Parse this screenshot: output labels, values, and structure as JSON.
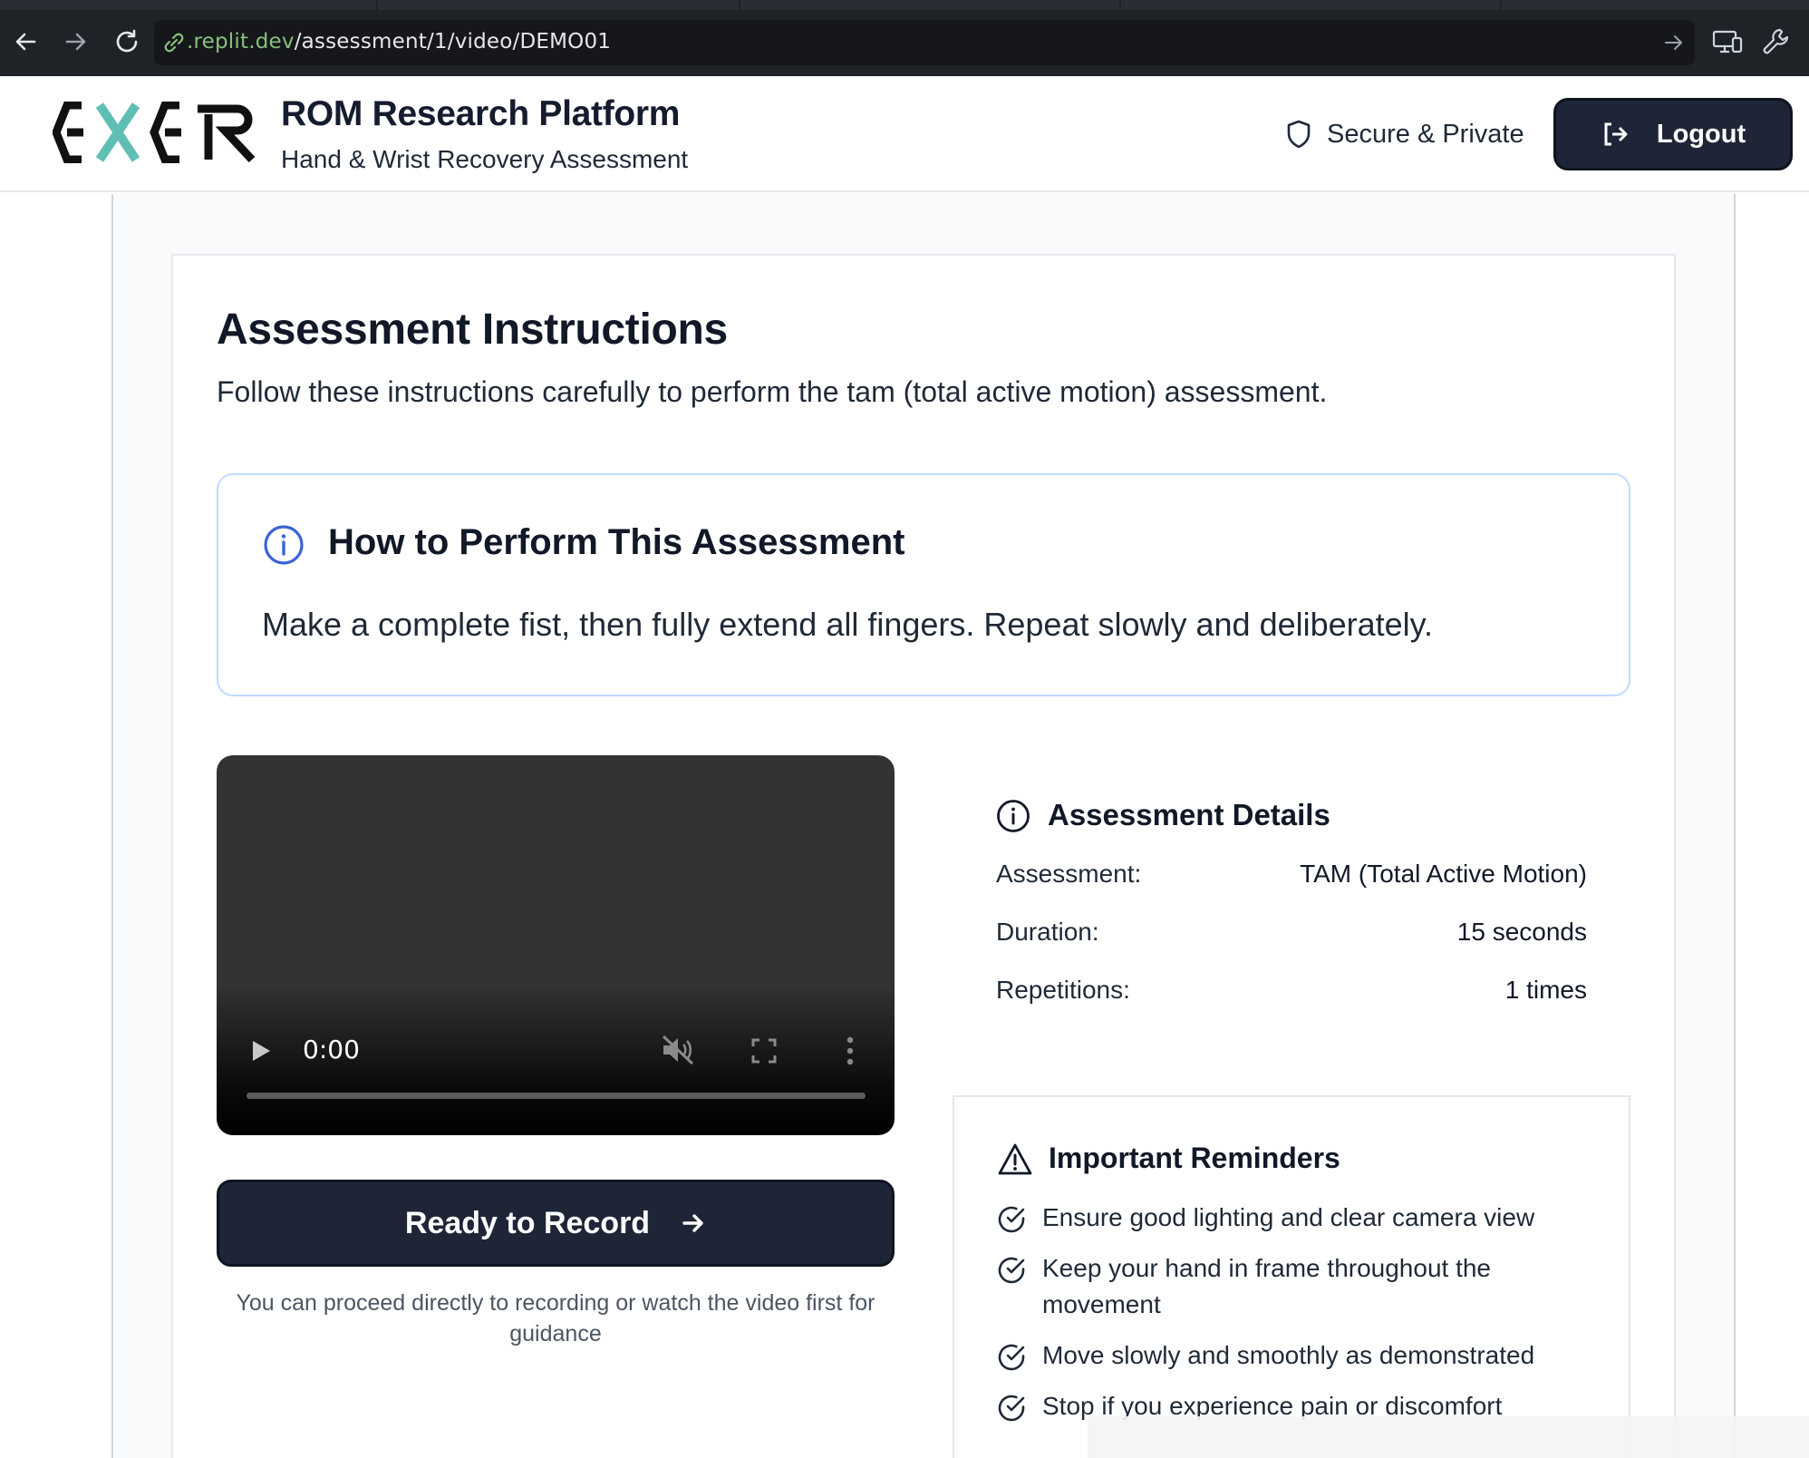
{
  "browser": {
    "url_host": ".replit.dev",
    "url_path": "/assessment/1/video/DEMO01"
  },
  "header": {
    "title": "ROM Research Platform",
    "subtitle": "Hand & Wrist Recovery Assessment",
    "secure_label": "Secure & Private",
    "logout_label": "Logout"
  },
  "instructions": {
    "title": "Assessment Instructions",
    "intro": "Follow these instructions carefully to perform the tam (total active motion) assessment.",
    "howto_title": "How to Perform This Assessment",
    "howto_text": "Make a complete fist, then fully extend all fingers. Repeat slowly and deliberately."
  },
  "video": {
    "time": "0:00",
    "progress": 0
  },
  "record": {
    "button_label": "Ready to Record",
    "note": "You can proceed directly to recording or watch the video first for guidance"
  },
  "details": {
    "title": "Assessment Details",
    "rows": [
      {
        "label": "Assessment:",
        "value": "TAM (Total Active Motion)"
      },
      {
        "label": "Duration:",
        "value": "15 seconds"
      },
      {
        "label": "Repetitions:",
        "value": "1 times"
      }
    ]
  },
  "reminders": {
    "title": "Important Reminders",
    "items": [
      "Ensure good lighting and clear camera view",
      "Keep your hand in frame throughout the movement",
      "Move slowly and smoothly as demonstrated",
      "Stop if you experience pain or discomfort"
    ]
  },
  "colors": {
    "primary_dark": "#1d2536",
    "accent_teal": "#5fbfb4",
    "info_blue": "#3b63d6",
    "url_host_green": "#86c17a"
  }
}
